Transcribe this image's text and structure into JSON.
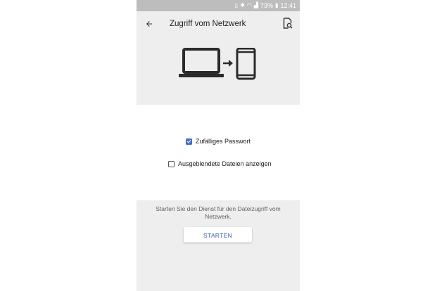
{
  "status_bar": {
    "battery": "73%",
    "time": "12:41",
    "icons": [
      "sim-icon",
      "bluetooth-icon",
      "wifi-icon",
      "signal-icon",
      "battery-icon"
    ]
  },
  "header": {
    "title": "Zugriff vom Netzwerk",
    "back_icon": "arrow-back-icon",
    "action_icon": "file-search-icon"
  },
  "illustration": {
    "icons": [
      "laptop-icon",
      "arrow-right-icon",
      "phone-icon"
    ]
  },
  "options": {
    "random_password": {
      "label": "Zufälliges Passwort",
      "checked": true
    },
    "show_hidden": {
      "label": "Ausgeblendete Dateien anzeigen",
      "checked": false
    }
  },
  "bottom": {
    "description": "Starten Sie den Dienst für den Dateizugriff vom Netzwerk.",
    "start_label": "STARTEN"
  },
  "colors": {
    "accent": "#4a6cc7",
    "header_bg": "#eeeeee",
    "status_bar_bg": "#bdbdbd",
    "button_text": "#3f5bb5"
  }
}
